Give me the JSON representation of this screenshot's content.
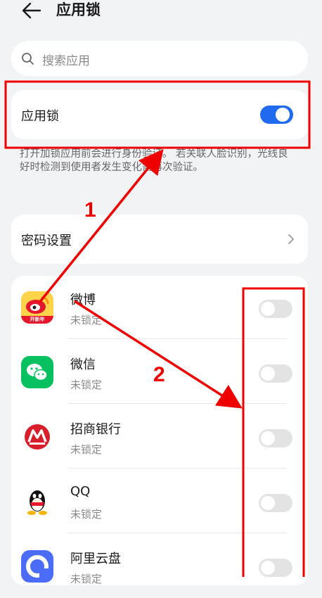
{
  "header": {
    "title": "应用锁"
  },
  "search": {
    "placeholder": "搜索应用"
  },
  "app_lock": {
    "label": "应用锁",
    "enabled": true
  },
  "description": "打开加锁应用前会进行身份验证。 若关联人脸识别，光线良好时检测到使用者发生变化需再次验证。",
  "password_settings": {
    "label": "密码设置"
  },
  "apps": [
    {
      "name": "微博",
      "status": "未锁定",
      "icon": "weibo-icon",
      "icon_badge": "开新年"
    },
    {
      "name": "微信",
      "status": "未锁定",
      "icon": "wechat-icon"
    },
    {
      "name": "招商银行",
      "status": "未锁定",
      "icon": "cmb-icon"
    },
    {
      "name": "QQ",
      "status": "未锁定",
      "icon": "qq-icon"
    },
    {
      "name": "阿里云盘",
      "status": "未锁定",
      "icon": "aliyun-drive-icon"
    }
  ],
  "annotations": {
    "step1": "1",
    "step2": "2",
    "color": "#e00000"
  },
  "colors": {
    "accent": "#1f6aee",
    "background": "#f1f3f5"
  }
}
